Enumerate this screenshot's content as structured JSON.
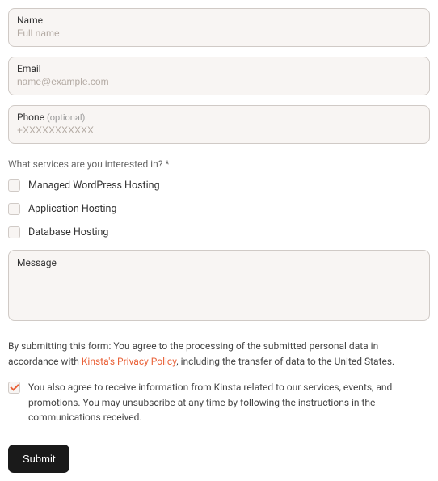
{
  "fields": {
    "name": {
      "label": "Name",
      "placeholder": "Full name"
    },
    "email": {
      "label": "Email",
      "placeholder": "name@example.com"
    },
    "phone": {
      "label": "Phone",
      "optional": "(optional)",
      "placeholder": "+XXXXXXXXXXX"
    }
  },
  "services": {
    "label": "What services are you interested in? *",
    "options": [
      "Managed WordPress Hosting",
      "Application Hosting",
      "Database Hosting"
    ]
  },
  "message": {
    "label": "Message"
  },
  "consent": {
    "prefix": "By submitting this form: You agree to the processing of the submitted personal data in accordance with ",
    "link": "Kinsta's Privacy Policy",
    "suffix": ", including the transfer of data to the United States."
  },
  "agree": {
    "text": "You also agree to receive information from Kinsta related to our services, events, and promotions. You may unsubscribe at any time by following the instructions in the communications received."
  },
  "submit": {
    "label": "Submit"
  }
}
